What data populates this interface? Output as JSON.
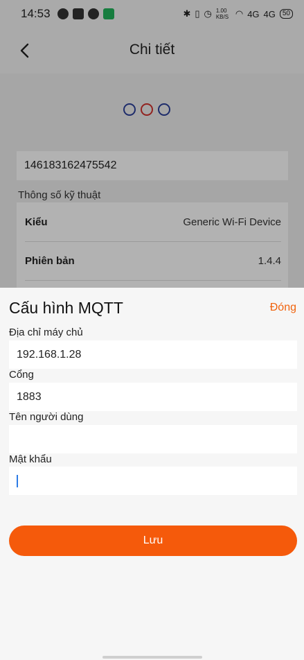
{
  "status_bar": {
    "time": "14:53",
    "net_speed": "1.00 KB/S",
    "signal1": "4G",
    "signal2": "4G",
    "battery": "50"
  },
  "header": {
    "title": "Chi tiết",
    "back_icon": "chevron-left-icon"
  },
  "device": {
    "id": "146183162475542",
    "spec_label": "Thông số kỹ thuật",
    "specs": [
      {
        "key": "Kiểu",
        "value": "Generic Wi-Fi Device"
      },
      {
        "key": "Phiên bản",
        "value": "1.4.4"
      }
    ]
  },
  "mqtt_sheet": {
    "title": "Cấu hình MQTT",
    "close_label": "Đóng",
    "fields": [
      {
        "label": "Địa chỉ máy chủ",
        "value": "192.168.1.28"
      },
      {
        "label": "Cổng",
        "value": "1883"
      },
      {
        "label": "Tên người dùng",
        "value": ""
      },
      {
        "label": "Mật khẩu",
        "value": ""
      }
    ],
    "save_label": "Lưu",
    "accent_color": "#f55a0b"
  }
}
